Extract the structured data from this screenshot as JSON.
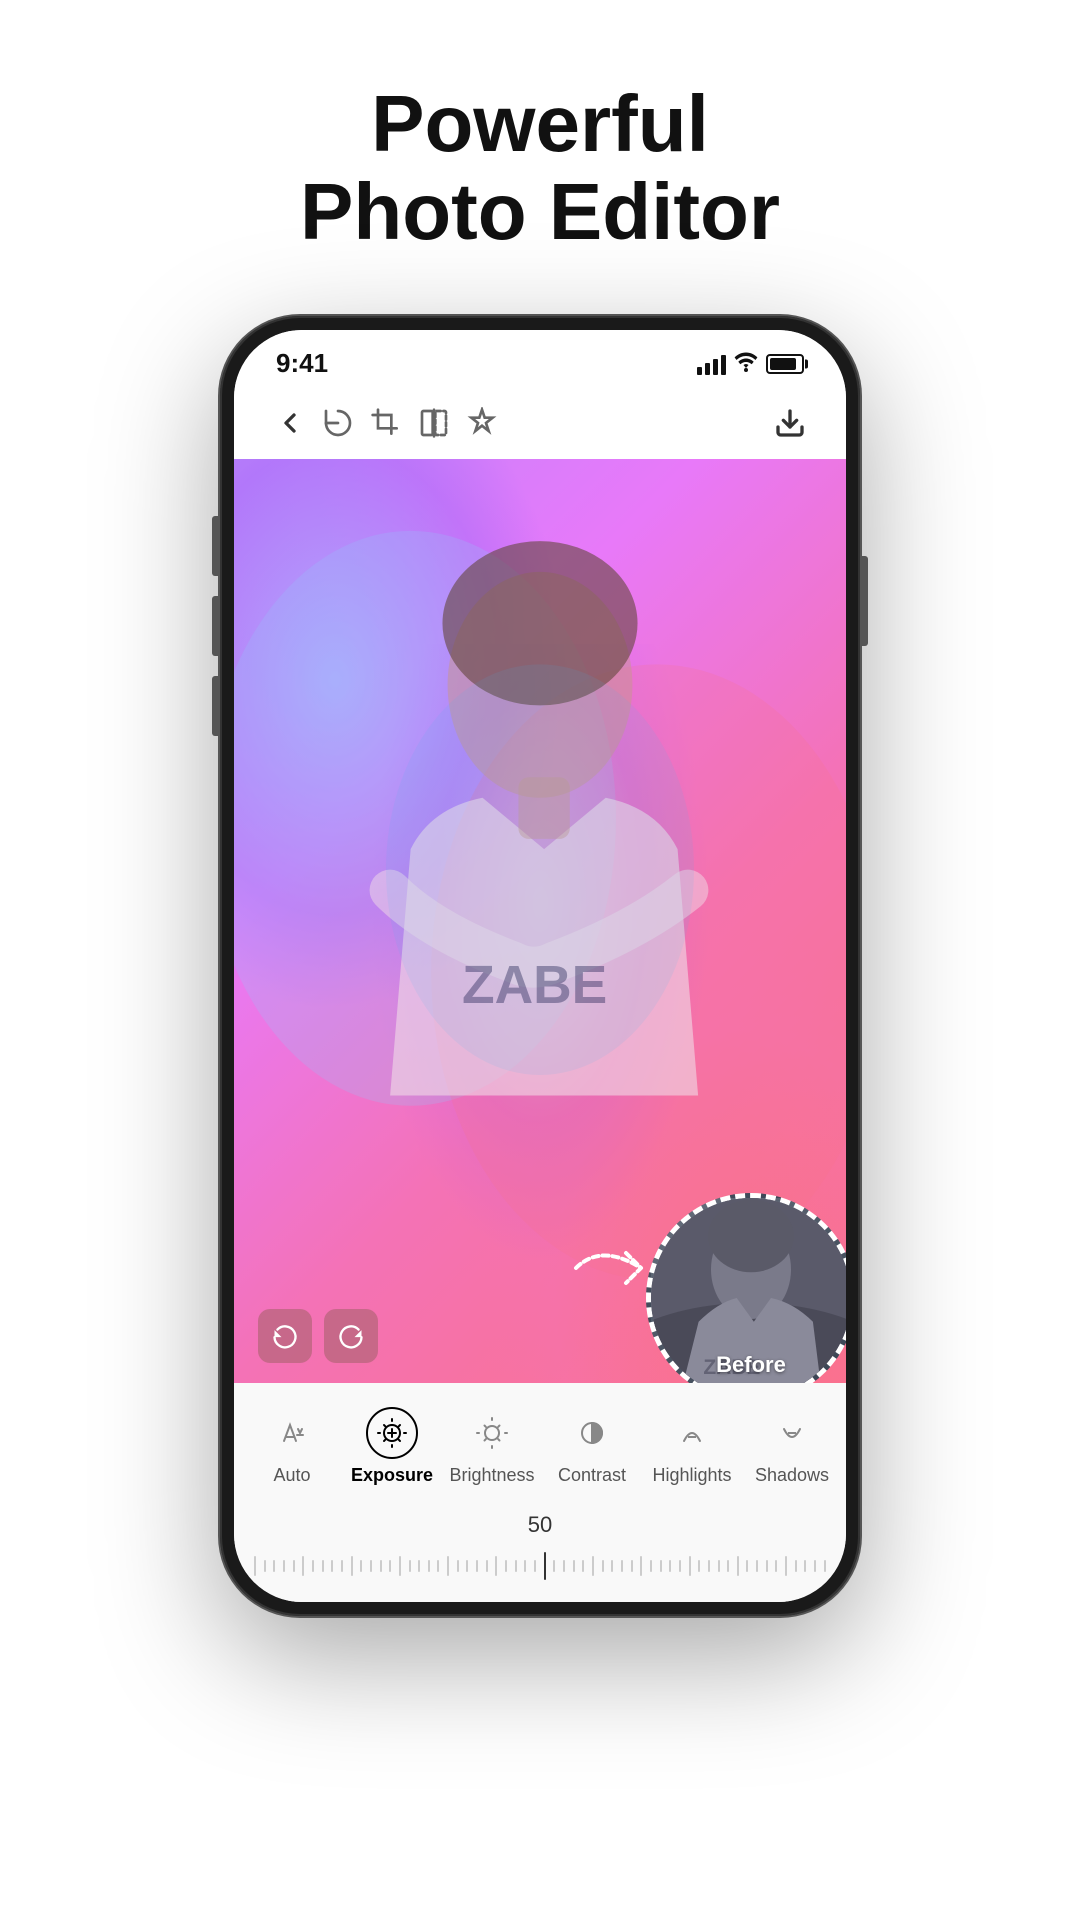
{
  "page": {
    "heading_line1": "Powerful",
    "heading_line2": "Photo Editor"
  },
  "status_bar": {
    "time": "9:41",
    "signal_alt": "signal bars",
    "wifi_alt": "wifi",
    "battery_alt": "battery"
  },
  "toolbar": {
    "back_label": "back",
    "rotate_label": "rotate",
    "crop_label": "crop",
    "flip_label": "flip",
    "adjust_label": "adjust",
    "download_label": "download"
  },
  "tools": [
    {
      "id": "auto",
      "label": "Auto",
      "active": false
    },
    {
      "id": "exposure",
      "label": "Exposure",
      "active": true
    },
    {
      "id": "brightness",
      "label": "Brightness",
      "active": false
    },
    {
      "id": "contrast",
      "label": "Contrast",
      "active": false
    },
    {
      "id": "highlights",
      "label": "Highlights",
      "active": false
    },
    {
      "id": "shadows",
      "label": "Shadows",
      "active": false
    }
  ],
  "slider": {
    "value": "50",
    "min": 0,
    "max": 100,
    "current": 50
  },
  "before_label": "Before",
  "colors": {
    "active": "#000000",
    "inactive": "#888888",
    "toolbar_icon": "#444444"
  }
}
